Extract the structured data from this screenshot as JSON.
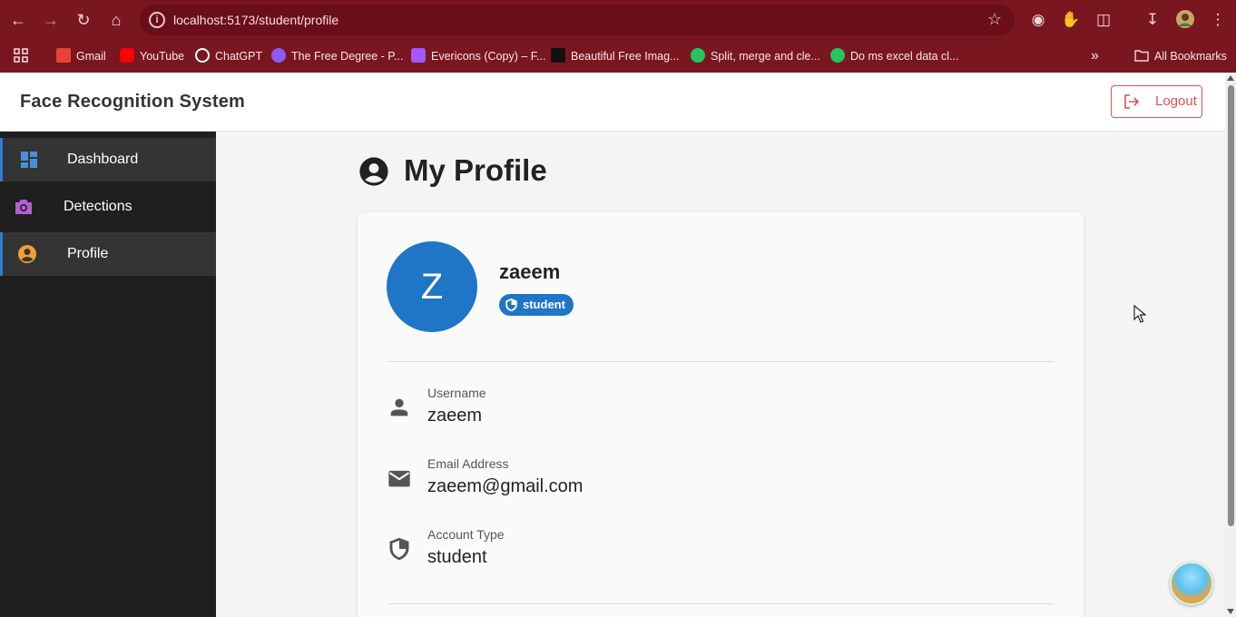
{
  "browser": {
    "url": "localhost:5173/student/profile",
    "bookmarks": [
      {
        "label": "Gmail",
        "color": "#ea4335"
      },
      {
        "label": "YouTube",
        "color": "#ff0000"
      },
      {
        "label": "ChatGPT",
        "color": "#ffffff"
      },
      {
        "label": "The Free Degree - P...",
        "color": "#8b5cf6"
      },
      {
        "label": "Evericons (Copy) – F...",
        "color": "#a259ff"
      },
      {
        "label": "Beautiful Free Imag...",
        "color": "#111111"
      },
      {
        "label": "Split, merge and cle...",
        "color": "#22c55e"
      },
      {
        "label": "Do ms excel data cl...",
        "color": "#22c55e"
      }
    ],
    "all_bookmarks": "All Bookmarks"
  },
  "header": {
    "title": "Face Recognition System",
    "logout_label": "Logout"
  },
  "sidebar": {
    "items": [
      {
        "label": "Dashboard",
        "icon": "dashboard-icon",
        "icon_color": "#4a90d9"
      },
      {
        "label": "Detections",
        "icon": "camera-icon",
        "icon_color": "#b35fd1"
      },
      {
        "label": "Profile",
        "icon": "account-circle-icon",
        "icon_color": "#f0a030",
        "active": true
      }
    ]
  },
  "main": {
    "title": "My Profile",
    "profile": {
      "avatar_letter": "Z",
      "name": "zaeem",
      "role": "student",
      "fields": [
        {
          "label": "Username",
          "value": "zaeem",
          "icon": "person-icon"
        },
        {
          "label": "Email Address",
          "value": "zaeem@gmail.com",
          "icon": "email-icon"
        },
        {
          "label": "Account Type",
          "value": "student",
          "icon": "shield-icon"
        }
      ]
    }
  },
  "colors": {
    "accent": "#1f75c6",
    "logout": "#d9534f",
    "sidebar_bg": "#1f1f1f",
    "chrome_bg": "#7a1620"
  }
}
